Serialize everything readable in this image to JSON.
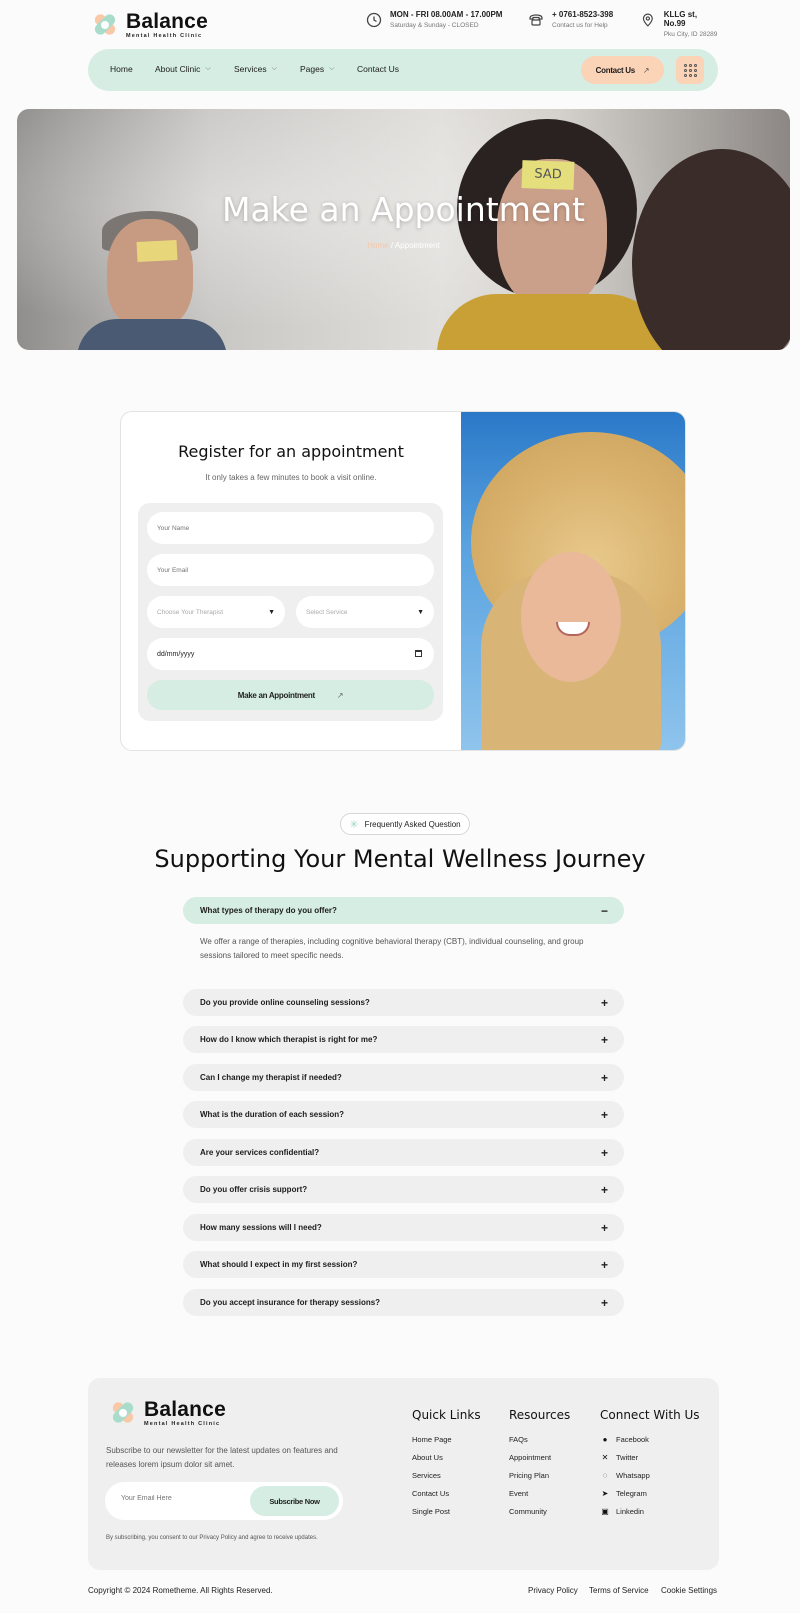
{
  "brand": {
    "name": "Balance",
    "tagline": "Mental Health Clinic"
  },
  "header_info": {
    "hours": {
      "title": "MON - FRI 08.00AM - 17.00PM",
      "sub": "Saturday & Sunday - CLOSED"
    },
    "phone": {
      "title": "+ 0761-8523-398",
      "sub": "Contact us for Help"
    },
    "address": {
      "title": "KLLG st, No.99",
      "sub": "Pku City, ID 28289"
    }
  },
  "nav": {
    "items": [
      "Home",
      "About Clinic",
      "Services",
      "Pages",
      "Contact Us"
    ],
    "contact_button": "Contact Us"
  },
  "hero": {
    "title": "Make an Appointment",
    "breadcrumb_home": "Home",
    "breadcrumb_sep": "/",
    "breadcrumb_current": "Appointment",
    "note_text": "SAD"
  },
  "appointment": {
    "title": "Register for an appointment",
    "subtitle": "It only takes a few minutes to book a visit online.",
    "name_placeholder": "Your Name",
    "email_placeholder": "Your Email",
    "therapist_select": "Choose Your Therapist",
    "service_select": "Select Service",
    "date_value": "dd/mm/yyyy",
    "submit_label": "Make an Appointment"
  },
  "faq": {
    "badge": "Frequently Asked Question",
    "title": "Supporting Your Mental Wellness Journey",
    "open_question": "What types of therapy do you offer?",
    "open_answer": "We offer a range of therapies, including cognitive behavioral therapy (CBT), individual counseling, and group sessions tailored to meet specific needs.",
    "questions": [
      "Do you provide online counseling sessions?",
      "How do I know which therapist is right for me?",
      "Can I change my therapist if needed?",
      "What is the duration of each session?",
      "Are your services confidential?",
      "Do you offer crisis support?",
      "How many sessions will I need?",
      "What should I expect in my first session?",
      "Do you accept insurance for therapy sessions?"
    ]
  },
  "footer": {
    "description": "Subscribe to our newsletter for the latest updates on features and releases lorem ipsum dolor sit amet.",
    "email_placeholder": "Your Email Here",
    "subscribe_label": "Subscribe Now",
    "consent": "By subscribing, you consent to our Privacy Policy and agree to receive updates.",
    "quick_links": {
      "title": "Quick Links",
      "items": [
        "Home Page",
        "About Us",
        "Services",
        "Contact Us",
        "Single Post"
      ]
    },
    "resources": {
      "title": "Resources",
      "items": [
        "FAQs",
        "Appointment",
        "Pricing Plan",
        "Event",
        "Community"
      ]
    },
    "connect": {
      "title": "Connect With Us",
      "items": [
        "Facebook",
        "Twitter",
        "Whatsapp",
        "Telegram",
        "Linkedin"
      ]
    },
    "copyright": "Copyright © 2024 Rometheme. All Rights Reserved.",
    "legal": [
      "Privacy Policy",
      "Terms of Service",
      "Cookie Settings"
    ]
  },
  "colors": {
    "mint": "#d5ede3",
    "peach": "#fbd3b7",
    "text": "#1c1c1c"
  }
}
